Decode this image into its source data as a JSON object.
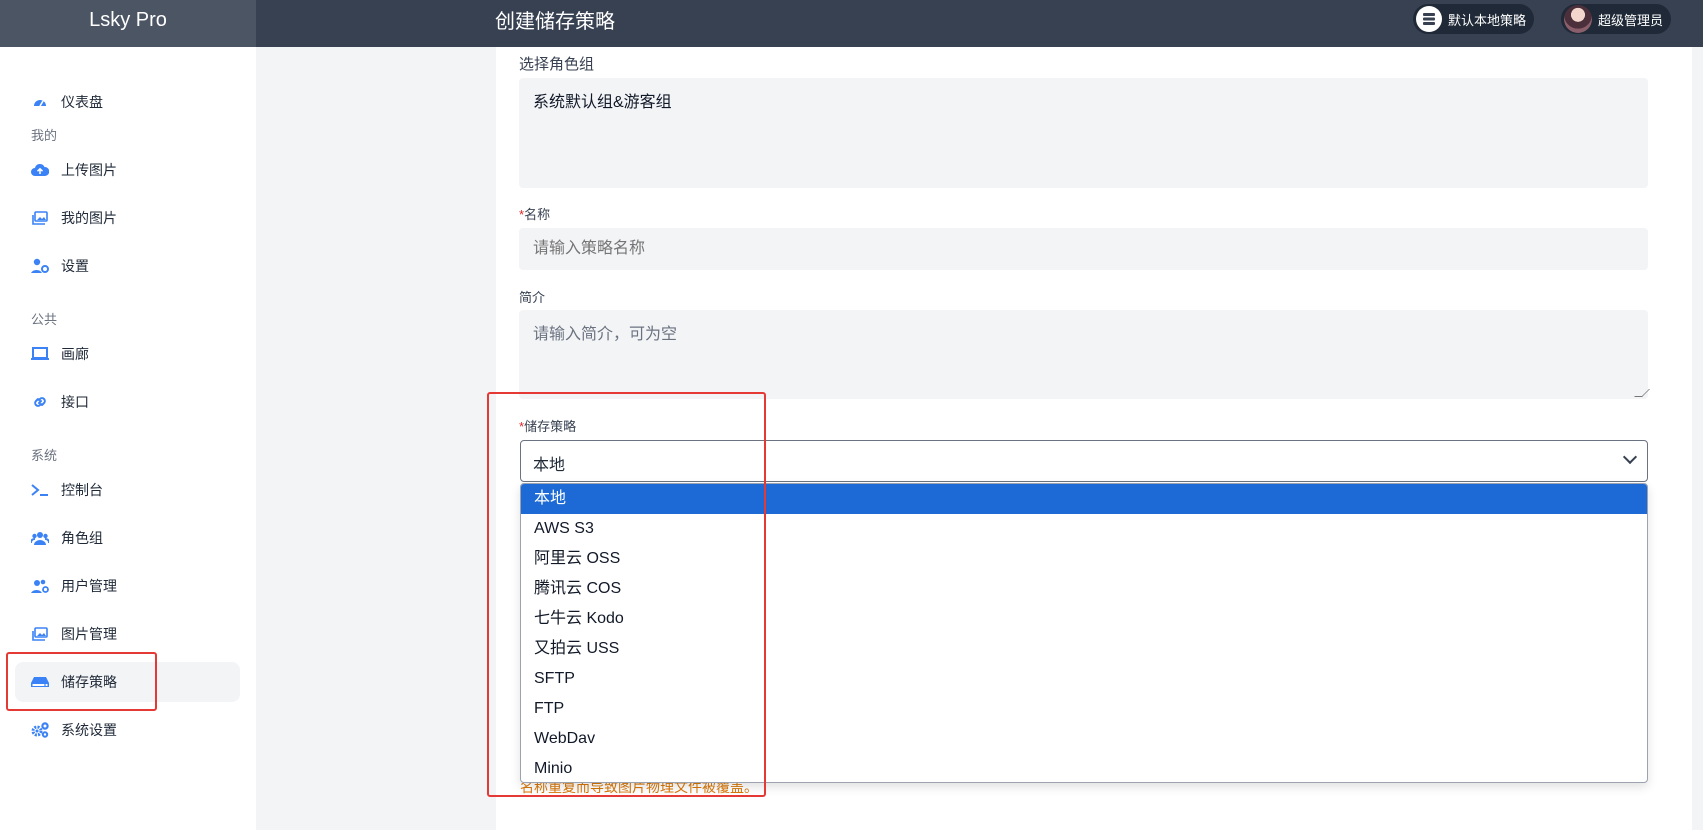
{
  "app": {
    "brand": "Lsky Pro",
    "page_title": "创建储存策略"
  },
  "header": {
    "strategy_label": "默认本地策略",
    "user_label": "超级管理员"
  },
  "sidebar": {
    "dashboard": "仪表盘",
    "section_mine": "我的",
    "upload": "上传图片",
    "my_images": "我的图片",
    "settings": "设置",
    "section_public": "公共",
    "gallery": "画廊",
    "api": "接口",
    "section_system": "系统",
    "console": "控制台",
    "roles": "角色组",
    "users": "用户管理",
    "images": "图片管理",
    "strategies": "储存策略",
    "system_settings": "系统设置"
  },
  "form": {
    "role_group_label": "选择角色组",
    "role_group_value": "系统默认组&游客组",
    "name_required": "*",
    "name_label": "名称",
    "name_placeholder": "请输入策略名称",
    "intro_label": "简介",
    "intro_placeholder": "请输入简介，可为空",
    "storage_required": "*",
    "storage_label": "储存策略",
    "storage_value": "本地",
    "storage_options": [
      "本地",
      "AWS S3",
      "阿里云 OSS",
      "腾讯云 COS",
      "七牛云 Kodo",
      "又拍云 USS",
      "SFTP",
      "FTP",
      "WebDav",
      "Minio"
    ],
    "warning_text": "名称重复而导致图片物理文件被覆盖。"
  },
  "colors": {
    "accent": "#1d6ad6",
    "highlight": "#e53935",
    "topbar": "#374151"
  }
}
